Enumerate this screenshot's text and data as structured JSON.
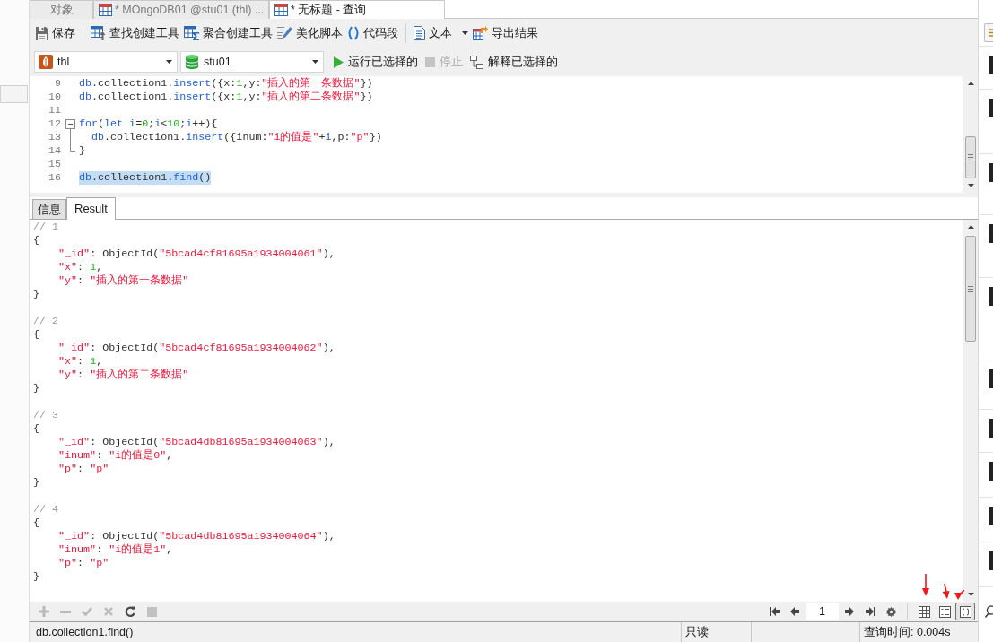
{
  "document_tabs": [
    {
      "kind": "plain",
      "label": "对象",
      "selected": false
    },
    {
      "kind": "table",
      "label": "* MOngoDB01 @stu01 (thl) ...",
      "selected": false
    },
    {
      "kind": "table",
      "label": "* 无标题 - 查询",
      "selected": true
    }
  ],
  "toolbar": {
    "groups": [
      [
        {
          "kind": "save",
          "label": "保存",
          "menu": false
        }
      ],
      [
        {
          "kind": "find_builder",
          "label": "查找创建工具",
          "menu": false
        },
        {
          "kind": "aggregate_builder",
          "label": "聚合创建工具",
          "menu": false
        },
        {
          "kind": "beautify",
          "label": "美化脚本",
          "menu": false
        },
        {
          "kind": "snippet",
          "label": "代码段",
          "menu": false
        }
      ],
      [
        {
          "kind": "text",
          "label": "文本",
          "menu": true
        },
        {
          "kind": "export",
          "label": "导出结果",
          "menu": false
        }
      ]
    ]
  },
  "query_bar": {
    "connection": {
      "value": "thl"
    },
    "database": {
      "value": "stu01"
    },
    "actions": [
      {
        "kind": "run",
        "label": "运行已选择的",
        "disabled": false
      },
      {
        "kind": "stop",
        "label": "停止",
        "disabled": true
      },
      {
        "kind": "explain",
        "label": "解释已选择的",
        "disabled": false
      }
    ]
  },
  "editor": {
    "lines": [
      {
        "kind": "code",
        "number": "9",
        "selected": false,
        "segments": [
          {
            "kind": "ident",
            "text": "db"
          },
          {
            "kind": "plain",
            "text": ".collection1."
          },
          {
            "kind": "ident",
            "text": "insert"
          },
          {
            "kind": "plain",
            "text": "({x:"
          },
          {
            "kind": "number",
            "text": "1"
          },
          {
            "kind": "plain",
            "text": ",y:"
          },
          {
            "kind": "string",
            "text": "\"插入的第一条数据\""
          },
          {
            "kind": "plain",
            "text": "})"
          }
        ]
      },
      {
        "kind": "code",
        "number": "10",
        "selected": false,
        "segments": [
          {
            "kind": "ident",
            "text": "db"
          },
          {
            "kind": "plain",
            "text": ".collection1."
          },
          {
            "kind": "ident",
            "text": "insert"
          },
          {
            "kind": "plain",
            "text": "({x:"
          },
          {
            "kind": "number",
            "text": "1"
          },
          {
            "kind": "plain",
            "text": ",y:"
          },
          {
            "kind": "string",
            "text": "\"插入的第二条数据\""
          },
          {
            "kind": "plain",
            "text": "})"
          }
        ]
      },
      {
        "kind": "code",
        "number": "11",
        "selected": false
      },
      {
        "kind": "fold_start",
        "number": "12",
        "selected": false,
        "expanded": true,
        "segments": [
          {
            "kind": "ident",
            "text": "for"
          },
          {
            "kind": "plain",
            "text": "("
          },
          {
            "kind": "ident",
            "text": "let i"
          },
          {
            "kind": "plain",
            "text": "="
          },
          {
            "kind": "number",
            "text": "0"
          },
          {
            "kind": "plain",
            "text": ";"
          },
          {
            "kind": "ident",
            "text": "i"
          },
          {
            "kind": "plain",
            "text": "<"
          },
          {
            "kind": "number",
            "text": "10"
          },
          {
            "kind": "plain",
            "text": ";"
          },
          {
            "kind": "ident",
            "text": "i"
          },
          {
            "kind": "plain",
            "text": "++){"
          }
        ]
      },
      {
        "kind": "fold_inside",
        "number": "13",
        "selected": false,
        "segments": [
          {
            "kind": "ident",
            "text": "  db"
          },
          {
            "kind": "plain",
            "text": ".collection1."
          },
          {
            "kind": "ident",
            "text": "insert"
          },
          {
            "kind": "plain",
            "text": "({inum:"
          },
          {
            "kind": "string",
            "text": "\"i的值是\""
          },
          {
            "kind": "plain",
            "text": "+"
          },
          {
            "kind": "ident",
            "text": "i"
          },
          {
            "kind": "plain",
            "text": ",p:"
          },
          {
            "kind": "string",
            "text": "\"p\""
          },
          {
            "kind": "plain",
            "text": "})"
          }
        ]
      },
      {
        "kind": "fold_end",
        "number": "14",
        "selected": false,
        "segments": [
          {
            "kind": "plain",
            "text": "}"
          }
        ]
      },
      {
        "kind": "code",
        "number": "15",
        "selected": false
      },
      {
        "kind": "code",
        "number": "16",
        "selected": true,
        "segments": [
          {
            "kind": "ident",
            "text": "db"
          },
          {
            "kind": "plain",
            "text": ".collection1."
          },
          {
            "kind": "ident",
            "text": "find"
          },
          {
            "kind": "plain",
            "text": "()"
          }
        ]
      }
    ]
  },
  "result_tabs": [
    {
      "label": "信息",
      "selected": false
    },
    {
      "label": "Result",
      "selected": true
    }
  ],
  "results": {
    "documents": [
      {
        "lines": [
          [
            {
              "kind": "comment",
              "text": "// 1"
            }
          ],
          [
            {
              "kind": "plain",
              "text": "{"
            }
          ],
          [
            {
              "kind": "key",
              "text": "    \"_id\""
            },
            {
              "kind": "plain",
              "text": ": ObjectId("
            },
            {
              "kind": "string",
              "text": "\"5bcad4cf81695a1934004061\""
            },
            {
              "kind": "plain",
              "text": "),"
            }
          ],
          [
            {
              "kind": "key",
              "text": "    \"x\""
            },
            {
              "kind": "plain",
              "text": ": "
            },
            {
              "kind": "number",
              "text": "1"
            },
            {
              "kind": "plain",
              "text": ","
            }
          ],
          [
            {
              "kind": "key",
              "text": "    \"y\""
            },
            {
              "kind": "plain",
              "text": ": "
            },
            {
              "kind": "string",
              "text": "\"插入的第一条数据\""
            }
          ],
          [
            {
              "kind": "plain",
              "text": "}"
            }
          ]
        ]
      },
      {
        "lines": [
          [
            {
              "kind": "comment",
              "text": "// 2"
            }
          ],
          [
            {
              "kind": "plain",
              "text": "{"
            }
          ],
          [
            {
              "kind": "key",
              "text": "    \"_id\""
            },
            {
              "kind": "plain",
              "text": ": ObjectId("
            },
            {
              "kind": "string",
              "text": "\"5bcad4cf81695a1934004062\""
            },
            {
              "kind": "plain",
              "text": "),"
            }
          ],
          [
            {
              "kind": "key",
              "text": "    \"x\""
            },
            {
              "kind": "plain",
              "text": ": "
            },
            {
              "kind": "number",
              "text": "1"
            },
            {
              "kind": "plain",
              "text": ","
            }
          ],
          [
            {
              "kind": "key",
              "text": "    \"y\""
            },
            {
              "kind": "plain",
              "text": ": "
            },
            {
              "kind": "string",
              "text": "\"插入的第二条数据\""
            }
          ],
          [
            {
              "kind": "plain",
              "text": "}"
            }
          ]
        ]
      },
      {
        "lines": [
          [
            {
              "kind": "comment",
              "text": "// 3"
            }
          ],
          [
            {
              "kind": "plain",
              "text": "{"
            }
          ],
          [
            {
              "kind": "key",
              "text": "    \"_id\""
            },
            {
              "kind": "plain",
              "text": ": ObjectId("
            },
            {
              "kind": "string",
              "text": "\"5bcad4db81695a1934004063\""
            },
            {
              "kind": "plain",
              "text": "),"
            }
          ],
          [
            {
              "kind": "key",
              "text": "    \"inum\""
            },
            {
              "kind": "plain",
              "text": ": "
            },
            {
              "kind": "string",
              "text": "\"i的值是0\""
            },
            {
              "kind": "plain",
              "text": ","
            }
          ],
          [
            {
              "kind": "key",
              "text": "    \"p\""
            },
            {
              "kind": "plain",
              "text": ": "
            },
            {
              "kind": "string",
              "text": "\"p\""
            }
          ],
          [
            {
              "kind": "plain",
              "text": "}"
            }
          ]
        ]
      },
      {
        "lines": [
          [
            {
              "kind": "comment",
              "text": "// 4"
            }
          ],
          [
            {
              "kind": "plain",
              "text": "{"
            }
          ],
          [
            {
              "kind": "key",
              "text": "    \"_id\""
            },
            {
              "kind": "plain",
              "text": ": ObjectId("
            },
            {
              "kind": "string",
              "text": "\"5bcad4db81695a1934004064\""
            },
            {
              "kind": "plain",
              "text": "),"
            }
          ],
          [
            {
              "kind": "key",
              "text": "    \"inum\""
            },
            {
              "kind": "plain",
              "text": ": "
            },
            {
              "kind": "string",
              "text": "\"i的值是1\""
            },
            {
              "kind": "plain",
              "text": ","
            }
          ],
          [
            {
              "kind": "key",
              "text": "    \"p\""
            },
            {
              "kind": "plain",
              "text": ": "
            },
            {
              "kind": "string",
              "text": "\"p\""
            }
          ],
          [
            {
              "kind": "plain",
              "text": "}"
            }
          ]
        ]
      }
    ]
  },
  "result_toolbar": {
    "record_actions": [
      {
        "kind": "add",
        "disabled": true
      },
      {
        "kind": "remove",
        "disabled": true
      },
      {
        "kind": "apply",
        "disabled": true
      },
      {
        "kind": "discard",
        "disabled": true
      },
      {
        "kind": "refresh",
        "disabled": false
      },
      {
        "kind": "stop",
        "disabled": true
      }
    ],
    "page": "1",
    "views": [
      {
        "kind": "grid",
        "selected": false
      },
      {
        "kind": "form",
        "selected": false
      },
      {
        "kind": "json",
        "selected": true
      }
    ]
  },
  "status_bar": {
    "statement": "db.collection1.find()",
    "mode": "只读",
    "query_time": "查询时间: 0.004s"
  }
}
